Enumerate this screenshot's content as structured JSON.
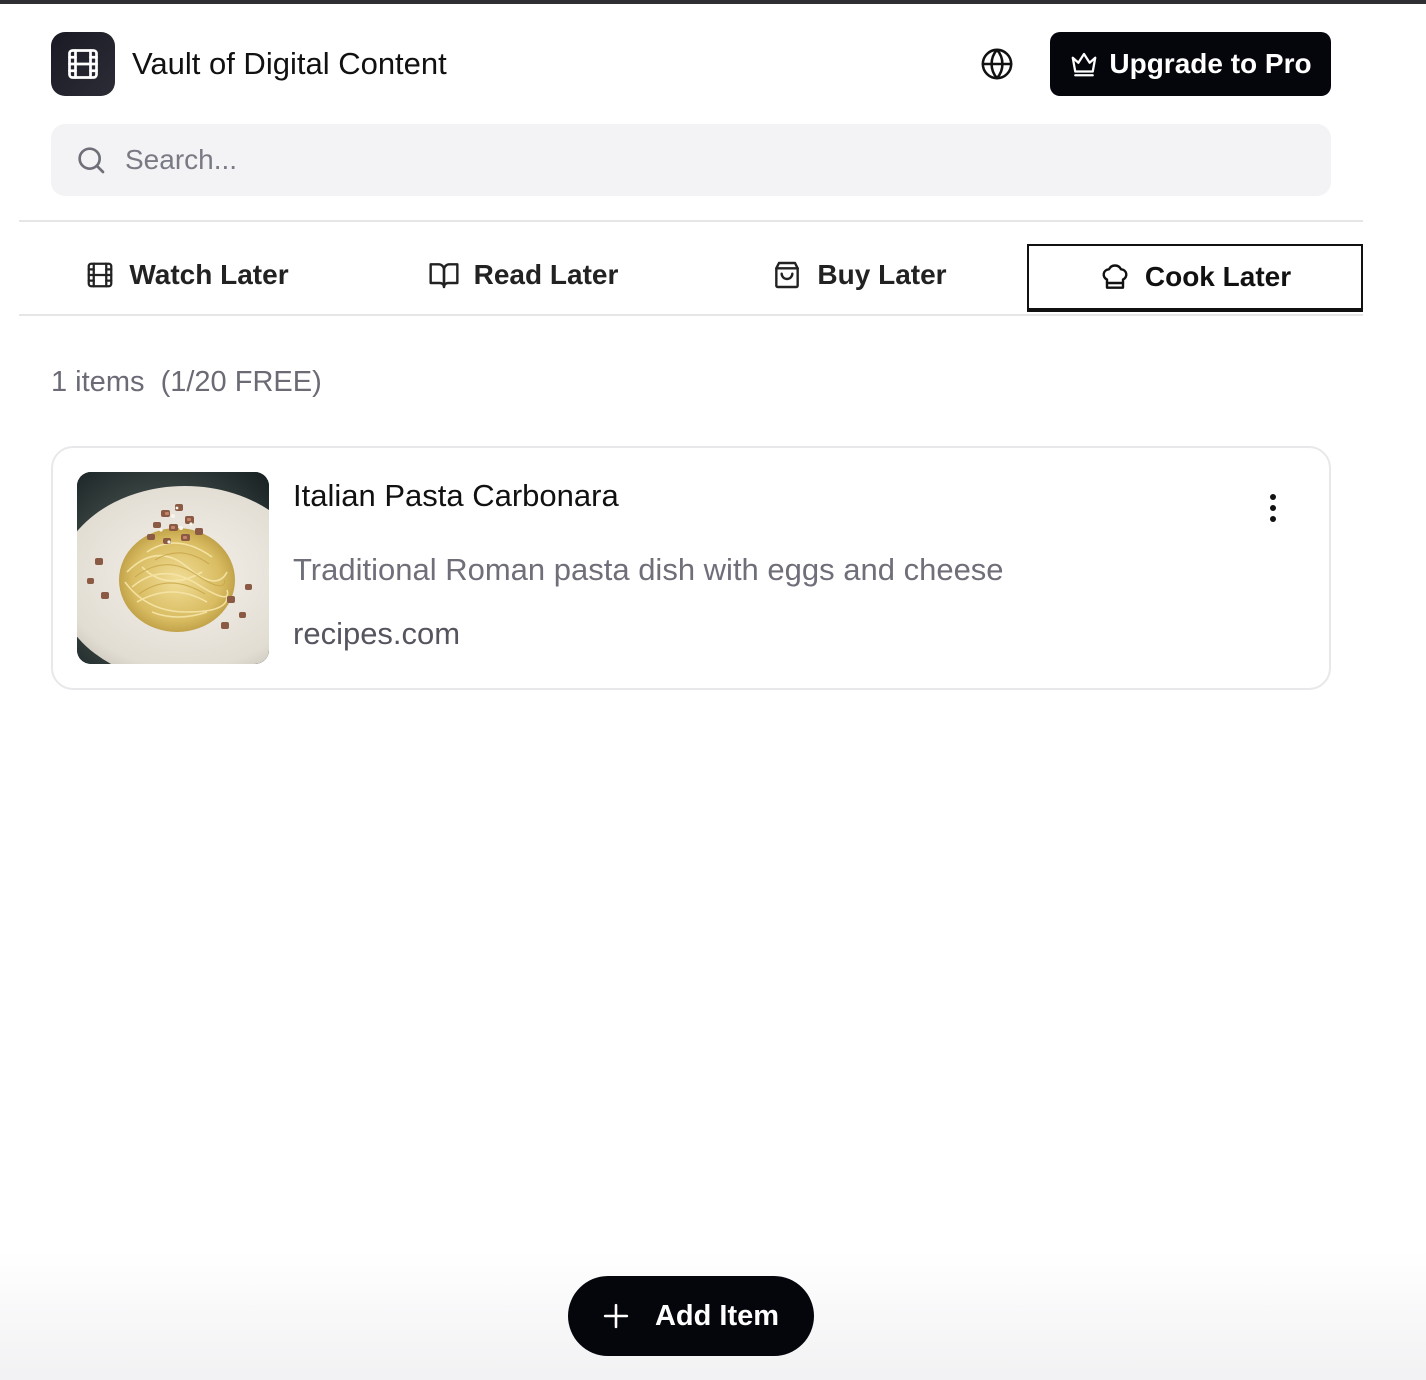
{
  "header": {
    "app_title": "Vault of Digital Content",
    "logo_icon": "film-icon",
    "globe_icon": "globe-icon",
    "upgrade_label": "Upgrade to Pro",
    "upgrade_icon": "crown-icon"
  },
  "search": {
    "placeholder": "Search...",
    "value": ""
  },
  "tabs": [
    {
      "label": "Watch Later",
      "icon": "film-icon",
      "active": false
    },
    {
      "label": "Read Later",
      "icon": "book-icon",
      "active": false
    },
    {
      "label": "Buy Later",
      "icon": "shopping-bag-icon",
      "active": false
    },
    {
      "label": "Cook Later",
      "icon": "chef-hat-icon",
      "active": true
    }
  ],
  "summary": {
    "count_text": "1 items  (1/20 FREE)"
  },
  "items": [
    {
      "title": "Italian Pasta Carbonara",
      "description": "Traditional Roman pasta dish with eggs and cheese",
      "source": "recipes.com",
      "thumbnail": "pasta-carbonara-photo"
    }
  ],
  "footer": {
    "add_label": "Add Item",
    "add_icon": "plus-icon"
  },
  "colors": {
    "primary": "#05050c",
    "muted_text": "#6f6f7a",
    "search_bg": "#f3f3f5",
    "border": "#e8e8eb"
  }
}
